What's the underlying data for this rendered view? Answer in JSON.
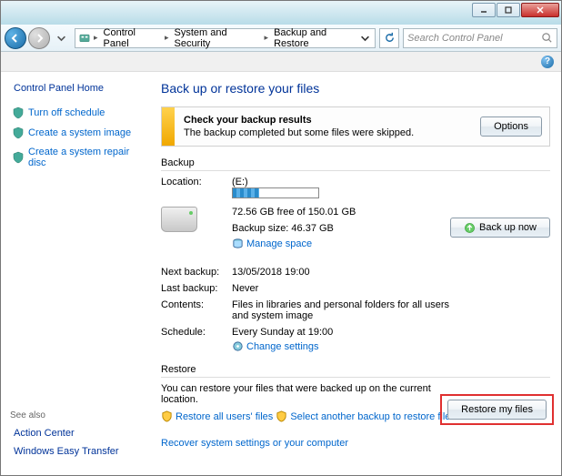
{
  "titlebar": {},
  "nav": {
    "breadcrumb": [
      "Control Panel",
      "System and Security",
      "Backup and Restore"
    ],
    "search_placeholder": "Search Control Panel"
  },
  "sidebar": {
    "home": "Control Panel Home",
    "links": [
      "Turn off schedule",
      "Create a system image",
      "Create a system repair disc"
    ],
    "seealso": "See also",
    "bottom": [
      "Action Center",
      "Windows Easy Transfer"
    ]
  },
  "content": {
    "heading": "Back up or restore your files",
    "alert": {
      "title": "Check your backup results",
      "body": "The backup completed but some files were skipped.",
      "button": "Options"
    },
    "backup_section": {
      "title": "Backup",
      "location_label": "Location:",
      "drive": "(E:)",
      "free": "72.56 GB free of 150.01 GB",
      "size": "Backup size: 46.37 GB",
      "manage": "Manage space",
      "backup_now": "Back up now",
      "rows": [
        {
          "label": "Next backup:",
          "value": "13/05/2018 19:00"
        },
        {
          "label": "Last backup:",
          "value": "Never"
        },
        {
          "label": "Contents:",
          "value": "Files in libraries and personal folders for all users and system image"
        },
        {
          "label": "Schedule:",
          "value": "Every Sunday at 19:00"
        }
      ],
      "change": "Change settings"
    },
    "restore_section": {
      "title": "Restore",
      "text": "You can restore your files that were backed up on the current location.",
      "restore_all": "Restore all users' files",
      "select_another": "Select another backup to restore files from",
      "recover": "Recover system settings or your computer",
      "restore_btn": "Restore my files"
    }
  }
}
